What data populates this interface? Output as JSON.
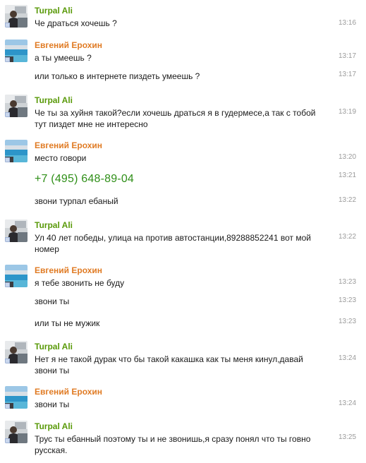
{
  "users": {
    "turpal": "Turpal Ali",
    "evgeny": "Евгений Ерохин"
  },
  "messages": [
    {
      "text": "Че драться хочешь ?",
      "time": "13:16"
    },
    {
      "text": "а ты умеешь ?",
      "time": "13:17"
    },
    {
      "text": "или только в интернете пиздеть умеешь ?",
      "time": "13:17"
    },
    {
      "text1": "Че ты за хуйня такой?если хочешь драться я в гудермесе,а так с тобой",
      "text2": "тут пиздет мне не интересно",
      "time": "13:19"
    },
    {
      "text": "место говори",
      "time": "13:20"
    },
    {
      "text": "+7 (495) 648-89-04",
      "time": "13:21"
    },
    {
      "text": "звони турпал ебаный",
      "time": "13:22"
    },
    {
      "text1": "Ул 40 лет победы, улица на против автостанции,89288852241 вот мой",
      "text2": "номер",
      "time": "13:22"
    },
    {
      "text": "я тебе звонить не буду",
      "time": "13:23"
    },
    {
      "text": "звони ты",
      "time": "13:23"
    },
    {
      "text": "или ты не мужик",
      "time": "13:23"
    },
    {
      "text1": "Нет я не такой дурак что бы такой какашка как ты меня кинул,давай",
      "text2": "звони ты",
      "time": "13:24"
    },
    {
      "text": "звони ты",
      "time": "13:24"
    },
    {
      "text1": "Трус ты ебанный поэтому ты и не звонишь,я сразу понял что ты говно",
      "text2": "русская.",
      "time": "13:25"
    }
  ],
  "colors": {
    "turpal_name": "#5a9a0a",
    "evgeny_name": "#e07b24",
    "phone": "#2f8f18",
    "time": "#9a9a9a"
  }
}
